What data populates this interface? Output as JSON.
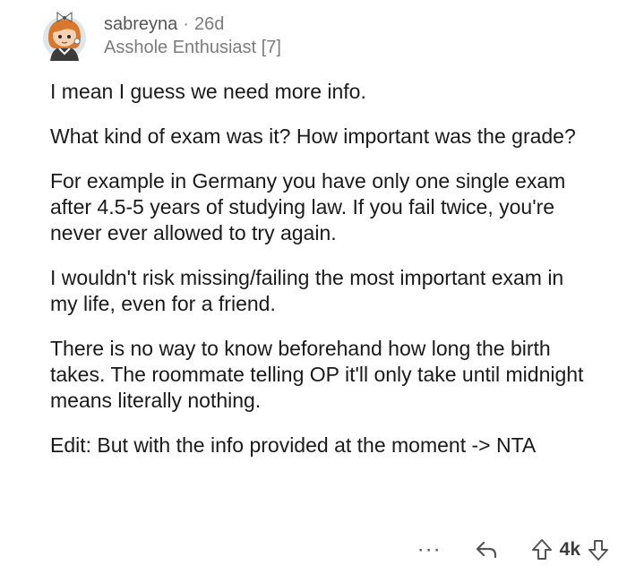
{
  "comment": {
    "username": "sabreyna",
    "separator": "·",
    "age": "26d",
    "flair": "Asshole Enthusiast [7]",
    "paragraphs": [
      "I mean I guess we need more info.",
      "What kind of exam was it? How important was the grade?",
      "For example in Germany you have only one single exam after 4.5-5 years of studying law. If you fail twice, you're never ever allowed to try again.",
      "I wouldn't risk missing/failing the most important exam in my life, even for a friend.",
      "There is no way to know beforehand how long the birth takes. The roommate telling OP it'll only take until midnight means literally nothing.",
      "Edit: But with the info provided at the moment -> NTA"
    ]
  },
  "actions": {
    "more_label": "···",
    "vote_count": "4k",
    "icons": {
      "more": "more-icon",
      "reply": "reply-icon",
      "upvote": "upvote-icon",
      "downvote": "downvote-icon"
    }
  },
  "colors": {
    "text": "#1a1a1b",
    "meta": "#7c7c7c"
  }
}
